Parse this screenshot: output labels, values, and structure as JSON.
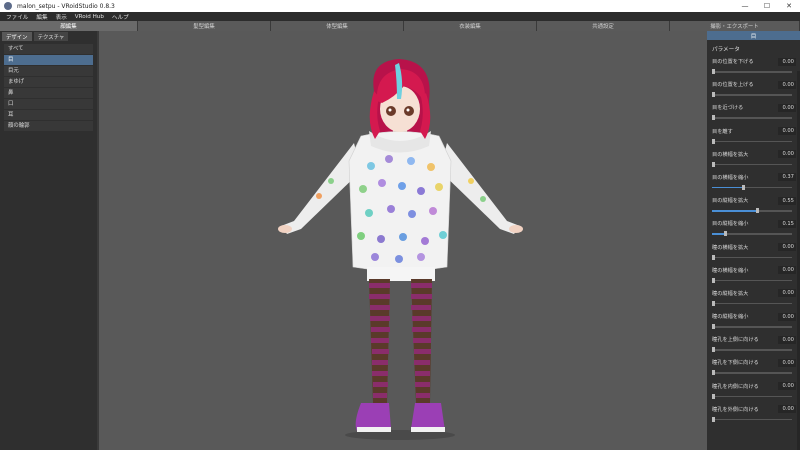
{
  "window": {
    "title": "malon_setpu - VRoidStudio 0.8.3",
    "controls": {
      "minimize": "—",
      "maximize": "☐",
      "close": "✕"
    }
  },
  "menu": [
    "ファイル",
    "編集",
    "表示",
    "VRoid Hub",
    "ヘルプ"
  ],
  "mode_tabs": [
    "顔編集",
    "髪型編集",
    "体型編集",
    "衣装編集",
    "共通設定",
    "撮影・エクスポート"
  ],
  "left_panel": {
    "tabs": [
      "デザイン",
      "テクスチャ"
    ],
    "items": [
      "すべて",
      "目",
      "目元",
      "まゆげ",
      "鼻",
      "口",
      "耳",
      "顔の輪郭"
    ]
  },
  "right_panel": {
    "header": "目",
    "section_title": "パラメータ",
    "params": [
      {
        "label": "目の位置を下げる",
        "value": "0.00",
        "fraction": 0.0
      },
      {
        "label": "目の位置を上げる",
        "value": "0.00",
        "fraction": 0.0
      },
      {
        "label": "目を近づける",
        "value": "0.00",
        "fraction": 0.0
      },
      {
        "label": "目を離す",
        "value": "0.00",
        "fraction": 0.0
      },
      {
        "label": "目の横幅を拡大",
        "value": "0.00",
        "fraction": 0.0
      },
      {
        "label": "目の横幅を縮小",
        "value": "0.37",
        "fraction": 0.37
      },
      {
        "label": "目の縦幅を拡大",
        "value": "0.55",
        "fraction": 0.55
      },
      {
        "label": "目の縦幅を縮小",
        "value": "0.15",
        "fraction": 0.15
      },
      {
        "label": "瞳の横幅を拡大",
        "value": "0.00",
        "fraction": 0.0
      },
      {
        "label": "瞳の横幅を縮小",
        "value": "0.00",
        "fraction": 0.0
      },
      {
        "label": "瞳の縦幅を拡大",
        "value": "0.00",
        "fraction": 0.0
      },
      {
        "label": "瞳の縦幅を縮小",
        "value": "0.00",
        "fraction": 0.0
      },
      {
        "label": "瞳孔を上側に向ける",
        "value": "0.00",
        "fraction": 0.0
      },
      {
        "label": "瞳孔を下側に向ける",
        "value": "0.00",
        "fraction": 0.0
      },
      {
        "label": "瞳孔を内側に向ける",
        "value": "0.00",
        "fraction": 0.0
      },
      {
        "label": "瞳孔を外側に向ける",
        "value": "0.00",
        "fraction": 0.0
      }
    ]
  },
  "colors": {
    "accent": "#4d6d8f",
    "slider_fill": "#4a8fd6",
    "hair": "#d4194f",
    "hoodie": "#f2f2f2",
    "stockings_a": "#8a2d6b",
    "stockings_b": "#5a3a2a"
  }
}
